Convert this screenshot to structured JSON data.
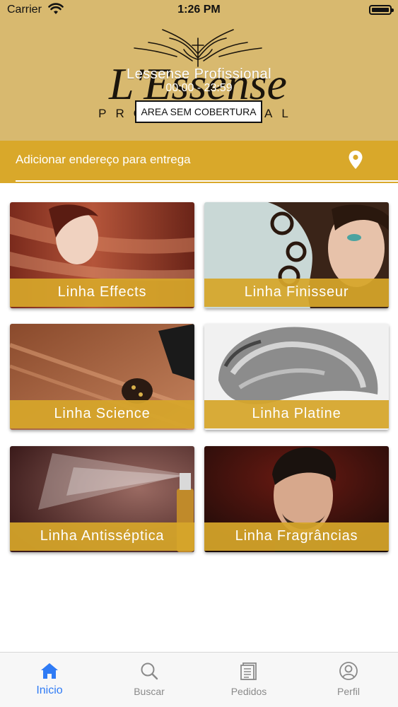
{
  "status_bar": {
    "carrier": "Carrier",
    "time": "1:26 PM"
  },
  "header": {
    "logo_text": "L'Essense",
    "logo_subtitle": "PROFISSIONAL",
    "store_name": "Lessense Profissional",
    "hours": "00:00 - 23:59",
    "coverage_badge": "AREA SEM COBERTURA"
  },
  "address_bar": {
    "label": "Adicionar endereço para entrega",
    "icon": "location-pin-icon"
  },
  "product_lines": [
    {
      "label": "Linha Effects"
    },
    {
      "label": "Linha Finisseur"
    },
    {
      "label": "Linha Science"
    },
    {
      "label": "Linha Platine"
    },
    {
      "label": "Linha Antisséptica"
    },
    {
      "label": "Linha Fragrâncias"
    }
  ],
  "tabs": [
    {
      "label": "Inicio",
      "icon": "home-icon",
      "active": true
    },
    {
      "label": "Buscar",
      "icon": "search-icon",
      "active": false
    },
    {
      "label": "Pedidos",
      "icon": "orders-icon",
      "active": false
    },
    {
      "label": "Perfil",
      "icon": "profile-icon",
      "active": false
    }
  ],
  "colors": {
    "header_bg": "#d8b96f",
    "accent_gold": "#d9a82a",
    "active_tab": "#2f7bf5",
    "inactive_tab": "#8a8a8a"
  }
}
